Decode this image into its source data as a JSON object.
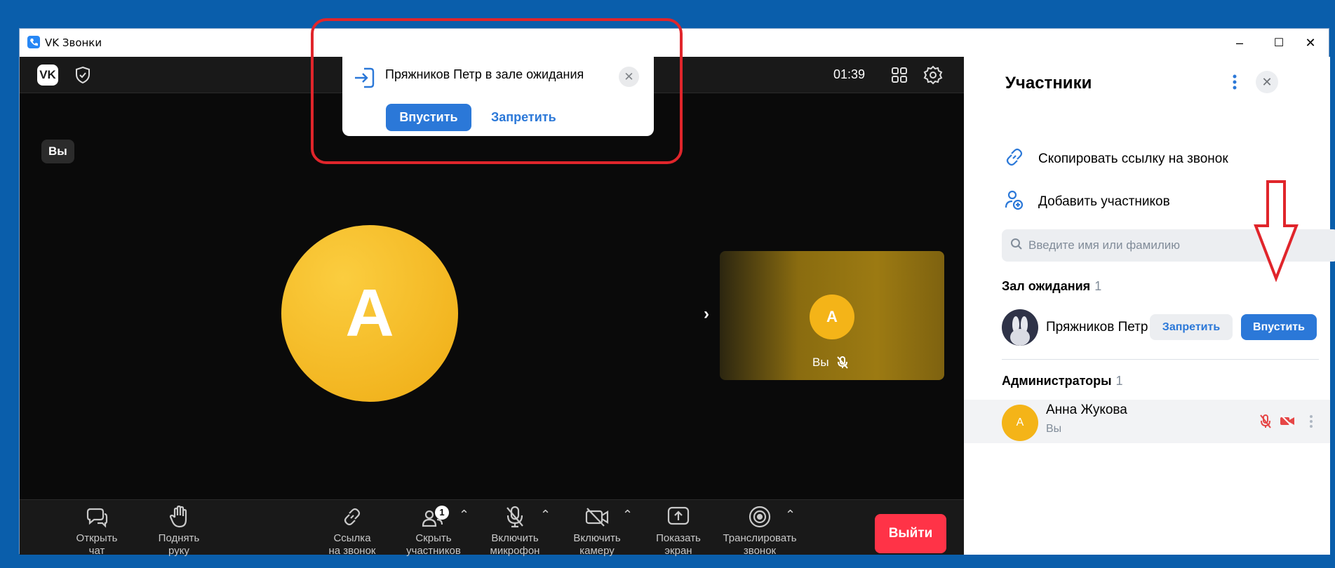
{
  "window": {
    "title": "VK Звонки",
    "minimize": "–",
    "maximize": "☐",
    "close": "✕"
  },
  "call": {
    "timer": "01:39",
    "you_badge": "Вы",
    "main_avatar_letter": "A",
    "tile_avatar_letter": "A",
    "tile_name": "Вы",
    "chevron": "›"
  },
  "popup": {
    "text": "Пряжников Петр в зале ожидания",
    "allow": "Впустить",
    "deny": "Запретить",
    "close": "✕"
  },
  "toolbar": {
    "chat_l1": "Открыть",
    "chat_l2": "чат",
    "hand_l1": "Поднять",
    "hand_l2": "руку",
    "link_l1": "Ссылка",
    "link_l2": "на звонок",
    "people_l1": "Скрыть",
    "people_l2": "участников",
    "people_badge": "1",
    "mic_l1": "Включить",
    "mic_l2": "микрофон",
    "cam_l1": "Включить",
    "cam_l2": "камеру",
    "screen_l1": "Показать",
    "screen_l2": "экран",
    "stream_l1": "Транслировать",
    "stream_l2": "звонок",
    "caret": "⌃",
    "exit": "Выйти"
  },
  "panel": {
    "title": "Участники",
    "close": "✕",
    "copy_link": "Скопировать ссылку на звонок",
    "add_participants": "Добавить участников",
    "search_placeholder": "Введите имя или фамилию",
    "waiting": {
      "header": "Зал ожидания",
      "count": "1",
      "name": "Пряжников Петр",
      "deny": "Запретить",
      "allow": "Впустить"
    },
    "admins": {
      "header": "Администраторы",
      "count": "1",
      "avatar_letter": "A",
      "name": "Анна Жукова",
      "sub": "Вы"
    }
  },
  "colors": {
    "accent": "#2b78d8",
    "danger": "#ff3347",
    "avatar": "#f4b418",
    "highlight": "#e0252b"
  }
}
